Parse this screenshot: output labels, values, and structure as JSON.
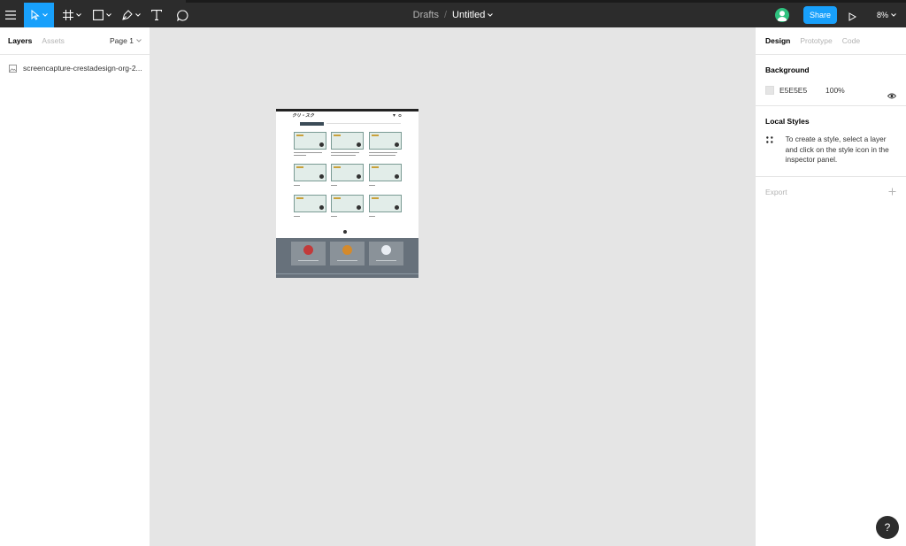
{
  "toolbar": {
    "breadcrumb": "Drafts",
    "separator": "/",
    "doc_title": "Untitled",
    "share_label": "Share",
    "zoom": "8%"
  },
  "left_panel": {
    "tabs": [
      {
        "label": "Layers",
        "active": true
      },
      {
        "label": "Assets",
        "active": false
      }
    ],
    "page_selector": "Page 1",
    "layers": [
      {
        "name": "screencapture-crestadesign-org-2..."
      }
    ]
  },
  "canvas": {
    "background": "#E5E5E5",
    "frame_logo": "クリ・スク"
  },
  "right_panel": {
    "tabs": [
      {
        "label": "Design",
        "active": true
      },
      {
        "label": "Prototype",
        "active": false
      },
      {
        "label": "Code",
        "active": false
      }
    ],
    "background": {
      "heading": "Background",
      "hex": "E5E5E5",
      "opacity": "100%"
    },
    "local_styles": {
      "heading": "Local Styles",
      "hint": "To create a style, select a layer and click on the style icon in the inspector panel."
    },
    "export": {
      "heading": "Export"
    }
  },
  "help": {
    "label": "?"
  },
  "colors": {
    "toolbar_bg": "#2C2C2C",
    "accent": "#18A0FB",
    "avatar": "#2FC27F"
  }
}
